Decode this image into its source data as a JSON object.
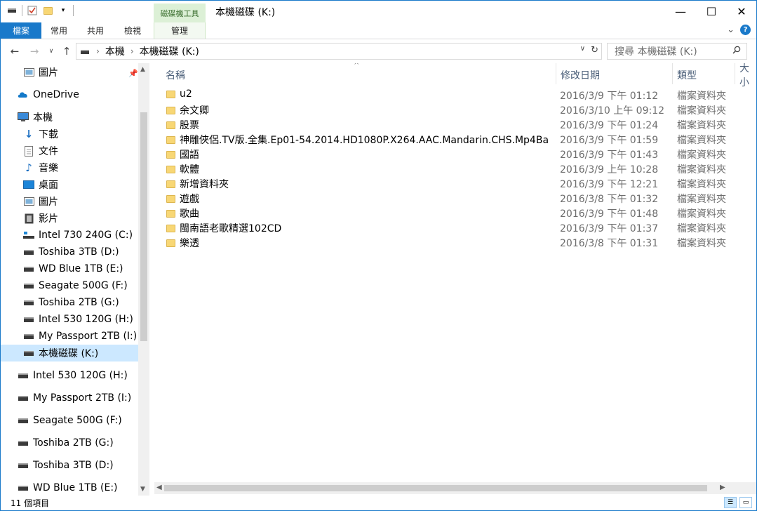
{
  "window": {
    "title": "本機磁碟 (K:)",
    "context_tab": "磁碟機工具",
    "minimize": "—",
    "maximize": "☐",
    "close": "✕"
  },
  "ribbon": {
    "tabs": [
      "檔案",
      "常用",
      "共用",
      "檢視",
      "管理"
    ],
    "expand": "⌄",
    "help": "?"
  },
  "address": {
    "crumbs": [
      "本機",
      "本機磁碟 (K:)"
    ],
    "search_placeholder": "搜尋 本機磁碟 (K:)"
  },
  "sidebar": {
    "items": [
      {
        "label": "圖片",
        "icon": "pictures-icon"
      },
      {
        "label": "OneDrive",
        "icon": "onedrive-icon"
      },
      {
        "label": "本機",
        "icon": "computer-icon"
      },
      {
        "label": "下載",
        "icon": "download-icon"
      },
      {
        "label": "文件",
        "icon": "documents-icon"
      },
      {
        "label": "音樂",
        "icon": "music-icon"
      },
      {
        "label": "桌面",
        "icon": "desktop-icon"
      },
      {
        "label": "圖片",
        "icon": "pictures-icon"
      },
      {
        "label": "影片",
        "icon": "videos-icon"
      },
      {
        "label": "Intel 730 240G (C:)",
        "icon": "system-drive-icon"
      },
      {
        "label": "Toshiba 3TB (D:)",
        "icon": "drive-icon"
      },
      {
        "label": "WD Blue 1TB (E:)",
        "icon": "drive-icon"
      },
      {
        "label": "Seagate 500G (F:)",
        "icon": "drive-icon"
      },
      {
        "label": "Toshiba 2TB (G:)",
        "icon": "drive-icon"
      },
      {
        "label": "Intel 530 120G (H:)",
        "icon": "drive-icon"
      },
      {
        "label": "My Passport 2TB (I:)",
        "icon": "drive-icon"
      },
      {
        "label": "本機磁碟 (K:)",
        "icon": "drive-icon"
      },
      {
        "label": "Intel 530 120G (H:)",
        "icon": "drive-icon"
      },
      {
        "label": "My Passport 2TB (I:)",
        "icon": "drive-icon"
      },
      {
        "label": "Seagate 500G (F:)",
        "icon": "drive-icon"
      },
      {
        "label": "Toshiba 2TB (G:)",
        "icon": "drive-icon"
      },
      {
        "label": "Toshiba 3TB (D:)",
        "icon": "drive-icon"
      },
      {
        "label": "WD Blue 1TB (E:)",
        "icon": "drive-icon"
      }
    ]
  },
  "columns": {
    "name": "名稱",
    "date": "修改日期",
    "type": "類型",
    "size": "大小"
  },
  "files": [
    {
      "name": "u2",
      "date": "2016/3/9 下午 01:12",
      "type": "檔案資料夾"
    },
    {
      "name": "余文卿",
      "date": "2016/3/10 上午 09:12",
      "type": "檔案資料夾"
    },
    {
      "name": "股票",
      "date": "2016/3/9 下午 01:24",
      "type": "檔案資料夾"
    },
    {
      "name": "神雕俠侶.TV版.全集.Ep01-54.2014.HD1080P.X264.AAC.Mandarin.CHS.Mp4Ba",
      "date": "2016/3/9 下午 01:59",
      "type": "檔案資料夾"
    },
    {
      "name": "國語",
      "date": "2016/3/9 下午 01:43",
      "type": "檔案資料夾"
    },
    {
      "name": "軟體",
      "date": "2016/3/9 上午 10:28",
      "type": "檔案資料夾"
    },
    {
      "name": "新增資料夾",
      "date": "2016/3/9 下午 12:21",
      "type": "檔案資料夾"
    },
    {
      "name": "遊戲",
      "date": "2016/3/8 下午 01:32",
      "type": "檔案資料夾"
    },
    {
      "name": "歌曲",
      "date": "2016/3/9 下午 01:48",
      "type": "檔案資料夾"
    },
    {
      "name": "閩南語老歌精選102CD",
      "date": "2016/3/9 下午 01:37",
      "type": "檔案資料夾"
    },
    {
      "name": "樂透",
      "date": "2016/3/8 下午 01:31",
      "type": "檔案資料夾"
    }
  ],
  "status": {
    "count": "11 個項目"
  }
}
